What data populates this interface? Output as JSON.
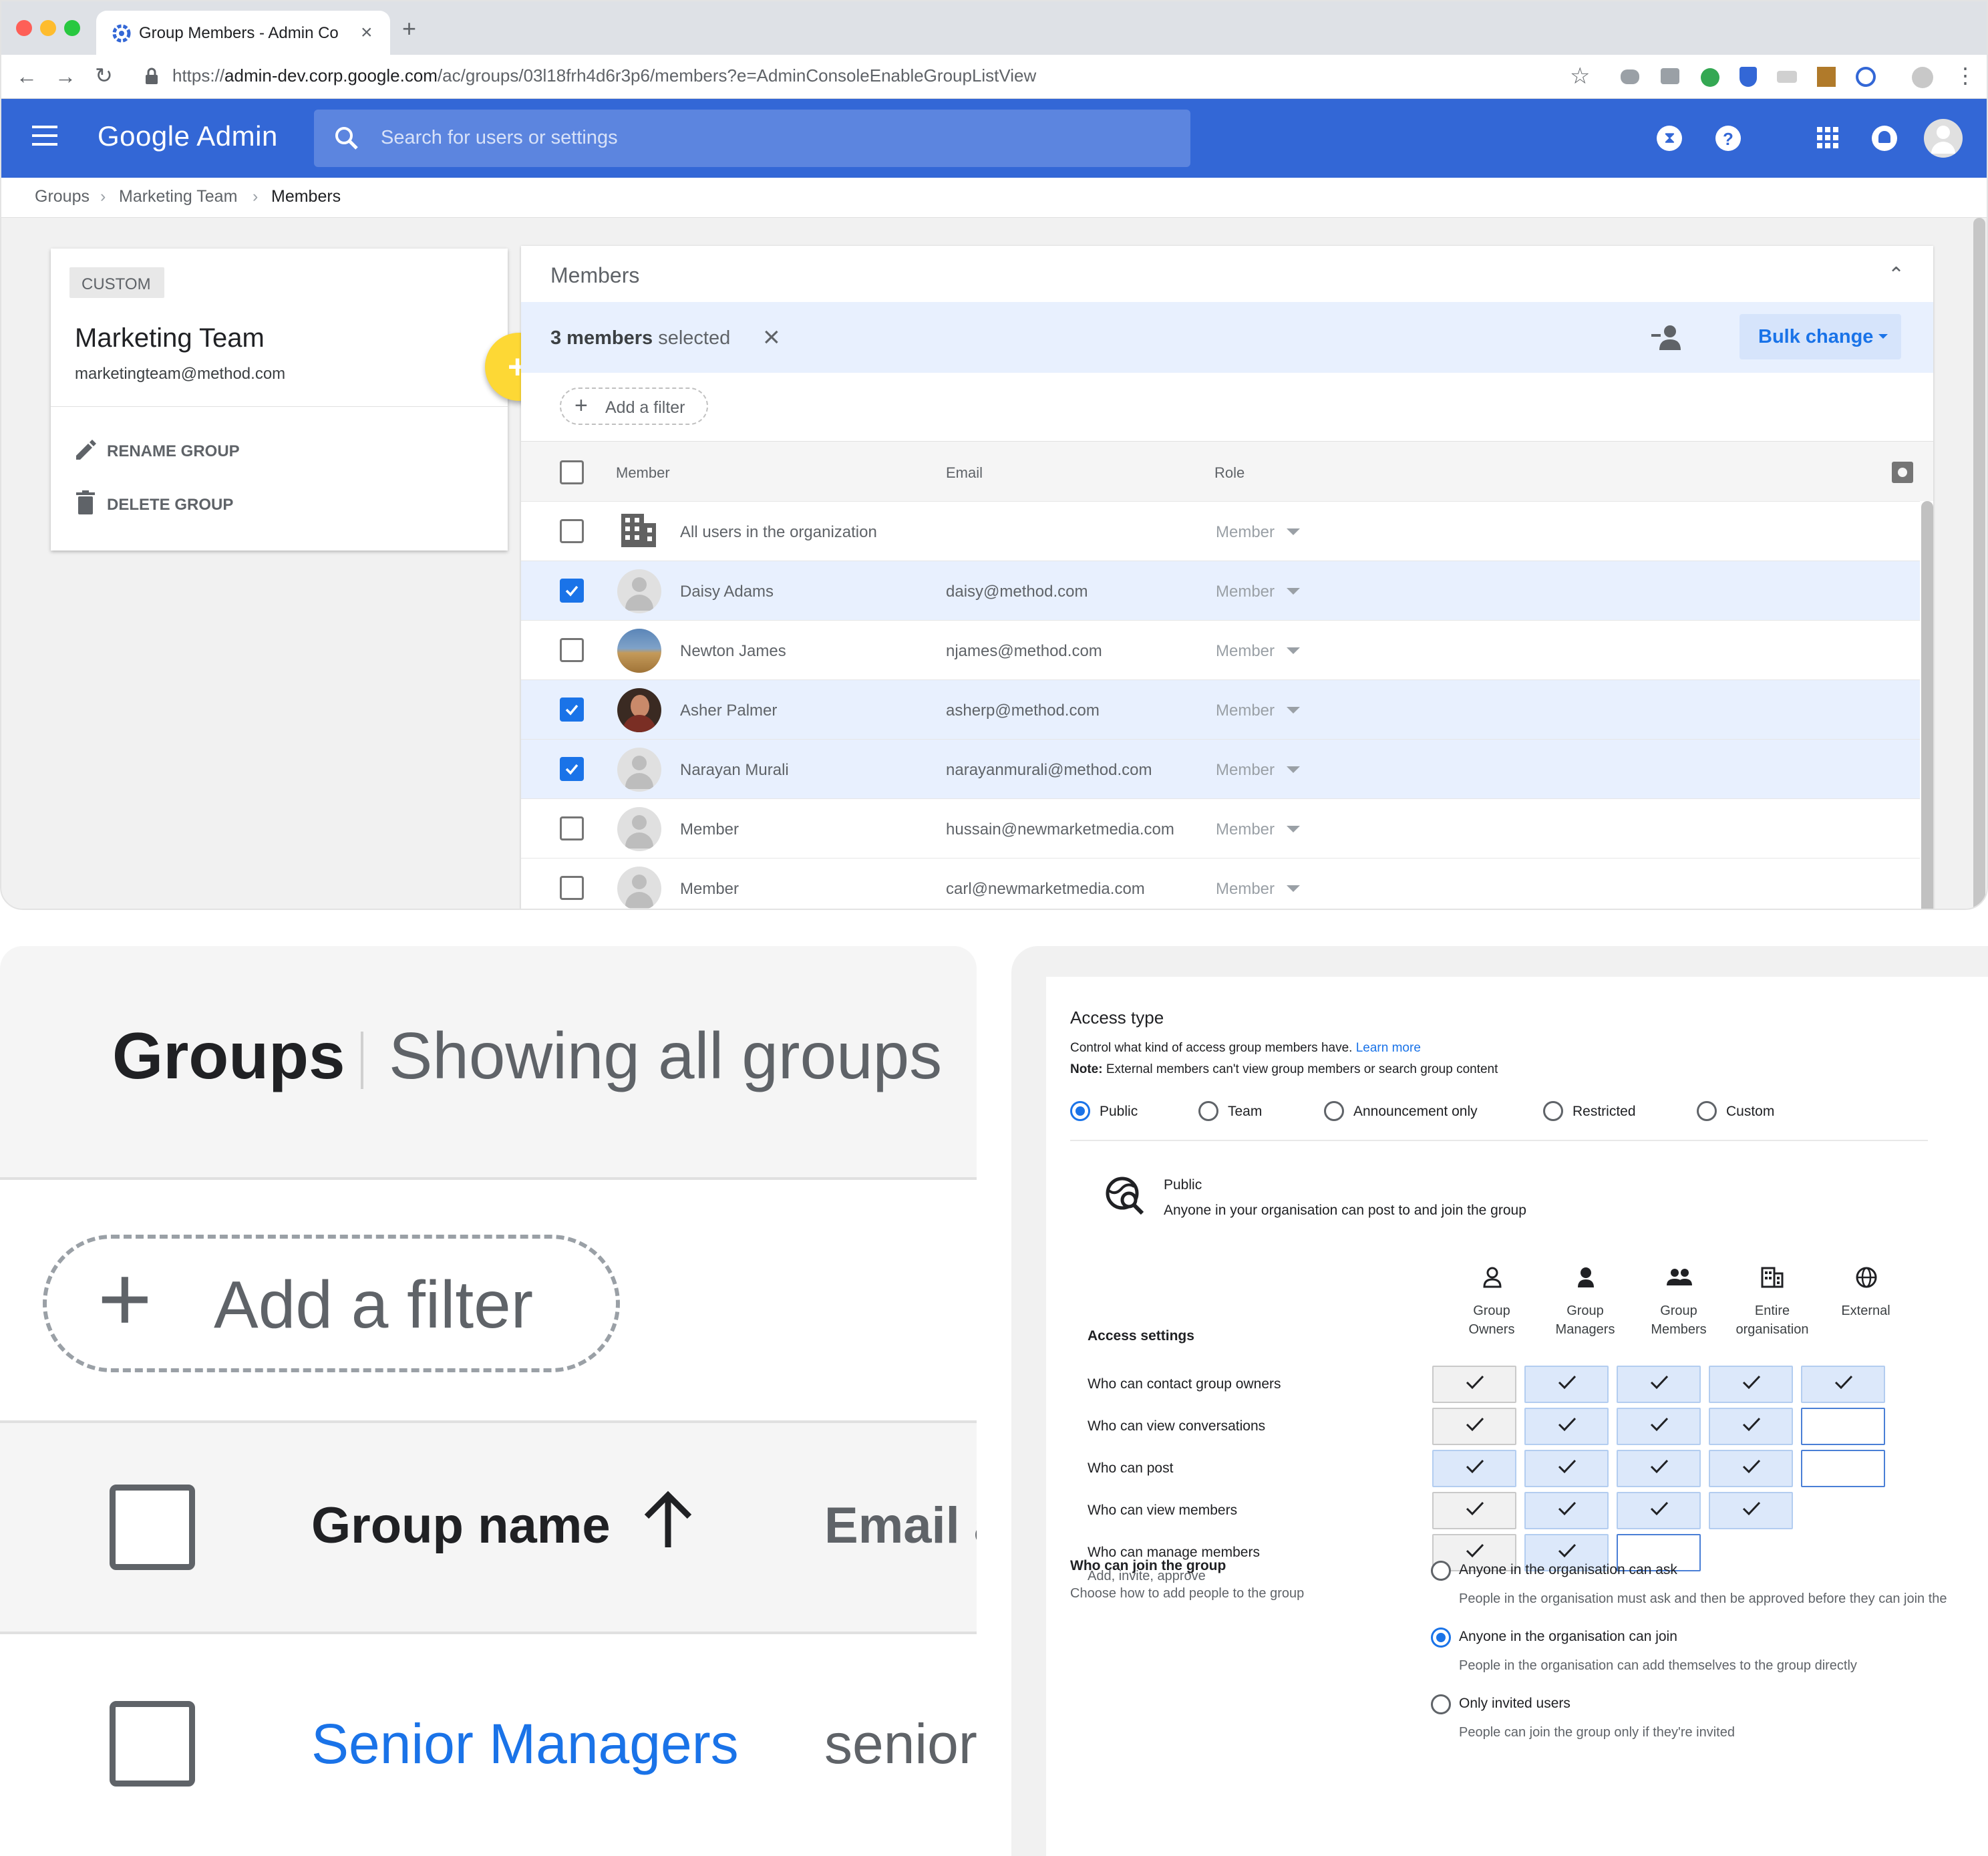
{
  "browser": {
    "tab_title": "Group Members - Admin Conso",
    "url_prefix": "https://",
    "url_host": "admin-dev.corp.google.com",
    "url_path": "/ac/groups/03l18frh4d6r3p6/members?e=AdminConsoleEnableGroupListView"
  },
  "app": {
    "logo_google": "Google",
    "logo_admin": "Admin",
    "search_placeholder": "Search for users or settings"
  },
  "breadcrumb": {
    "items": [
      "Groups",
      "Marketing Team",
      "Members"
    ]
  },
  "group_card": {
    "badge": "CUSTOM",
    "name": "Marketing Team",
    "email": "marketingteam@method.com",
    "rename_label": "RENAME GROUP",
    "delete_label": "DELETE GROUP"
  },
  "members_panel": {
    "title": "Members",
    "selected_count": "3 members",
    "selected_suffix": " selected",
    "bulk_change": "Bulk change",
    "add_filter": "Add a filter",
    "col_member": "Member",
    "col_email": "Email",
    "col_role": "Role",
    "rows": [
      {
        "name": "All users in the organization",
        "email": "",
        "role": "Member",
        "checked": false,
        "avatar": "building"
      },
      {
        "name": "Daisy Adams",
        "email": "daisy@method.com",
        "role": "Member",
        "checked": true,
        "avatar": "default"
      },
      {
        "name": "Newton James",
        "email": "njames@method.com",
        "role": "Member",
        "checked": false,
        "avatar": "photo-landscape"
      },
      {
        "name": "Asher Palmer",
        "email": "asherp@method.com",
        "role": "Member",
        "checked": true,
        "avatar": "photo-person"
      },
      {
        "name": "Narayan Murali",
        "email": "narayanmurali@method.com",
        "role": "Member",
        "checked": true,
        "avatar": "default"
      },
      {
        "name": "Member",
        "email": "hussain@newmarketmedia.com",
        "role": "Member",
        "checked": false,
        "avatar": "default"
      },
      {
        "name": "Member",
        "email": "carl@newmarketmedia.com",
        "role": "Member",
        "checked": false,
        "avatar": "default"
      }
    ]
  },
  "zoom": {
    "title": "Groups",
    "subtitle": "Showing all groups",
    "add_filter": "Add a filter",
    "col_group_name": "Group name",
    "col_email_partial": "Email a",
    "row_name": "Senior Managers",
    "row_email_partial": "senior"
  },
  "access": {
    "title": "Access type",
    "description": "Control what kind of access group members have.",
    "learn_more": "Learn more",
    "note_label": "Note:",
    "note_text": " External members can't view group members or search group content",
    "types": [
      "Public",
      "Team",
      "Announcement only",
      "Restricted",
      "Custom"
    ],
    "selected_type": "Public",
    "public_title": "Public",
    "public_desc": "Anyone in your organisation can post to and join the group",
    "settings_label": "Access settings",
    "columns": [
      {
        "line1": "Group",
        "line2": "Owners",
        "icon": "owner-icon"
      },
      {
        "line1": "Group",
        "line2": "Managers",
        "icon": "manager-icon"
      },
      {
        "line1": "Group",
        "line2": "Members",
        "icon": "members-icon"
      },
      {
        "line1": "Entire",
        "line2": "organisation",
        "icon": "building-icon"
      },
      {
        "line1": "External",
        "line2": "",
        "icon": "globe-icon"
      }
    ],
    "settings": [
      {
        "label": "Who can contact group owners",
        "sub": "",
        "cells": [
          "check-grey",
          "check",
          "check",
          "check",
          "check"
        ]
      },
      {
        "label": "Who can view conversations",
        "sub": "",
        "cells": [
          "check-grey",
          "check",
          "check",
          "check",
          "empty"
        ]
      },
      {
        "label": "Who can post",
        "sub": "",
        "cells": [
          "check",
          "check",
          "check",
          "check",
          "empty"
        ]
      },
      {
        "label": "Who can view members",
        "sub": "",
        "cells": [
          "check-grey",
          "check",
          "check",
          "check",
          "none"
        ]
      },
      {
        "label": "Who can manage members",
        "sub": "Add, invite, approve",
        "cells": [
          "check-grey",
          "check",
          "empty",
          "none",
          "none"
        ]
      }
    ],
    "join_title": "Who can join the group",
    "join_sub": "Choose how to add people to the group",
    "join_options": [
      {
        "label": "Anyone in the organisation can ask",
        "desc": "People in the organisation must ask and then be approved before they can join the",
        "selected": false
      },
      {
        "label": "Anyone in the organisation can join",
        "desc": "People in the organisation can add themselves to the group directly",
        "selected": true
      },
      {
        "label": "Only invited users",
        "desc": "People can join the group only if they're invited",
        "selected": false
      }
    ]
  },
  "colors": {
    "brand_blue": "#3367d6",
    "selected_row": "#e8f0fe",
    "checkbox_blue": "#1a73e8",
    "fab_yellow": "#fdd835",
    "link_blue": "#1a73e8"
  }
}
